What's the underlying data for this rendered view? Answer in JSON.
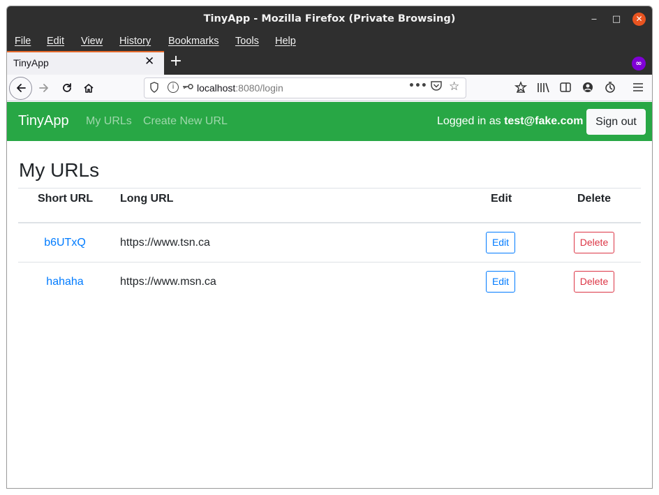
{
  "window": {
    "title": "TinyApp - Mozilla Firefox (Private Browsing)",
    "controls": {
      "minimize": "‒",
      "maximize": "□",
      "close": "✕"
    }
  },
  "menu": [
    "File",
    "Edit",
    "View",
    "History",
    "Bookmarks",
    "Tools",
    "Help"
  ],
  "tab": {
    "label": "TinyApp",
    "close": "✕",
    "new_tab": "+"
  },
  "private_icon": "∞",
  "urlbar": {
    "host": "localhost",
    "rest": ":8080/login"
  },
  "site": {
    "brand": "TinyApp",
    "nav_links": [
      "My URLs",
      "Create New URL"
    ],
    "logged_in_prefix": "Logged in as",
    "logged_in_user": "test@fake.com",
    "signout_label": "Sign out",
    "brand_color": "#28a745"
  },
  "page": {
    "heading": "My URLs",
    "columns": [
      "Short URL",
      "Long URL",
      "Edit",
      "Delete"
    ],
    "rows": [
      {
        "short": "b6UTxQ",
        "long": "https://www.tsn.ca",
        "edit": "Edit",
        "delete": "Delete"
      },
      {
        "short": "hahaha",
        "long": "https://www.msn.ca",
        "edit": "Edit",
        "delete": "Delete"
      }
    ]
  },
  "colors": {
    "link": "#007bff",
    "danger": "#dc3545",
    "tab_accent": "#e66a2c",
    "private": "#8000d7"
  }
}
